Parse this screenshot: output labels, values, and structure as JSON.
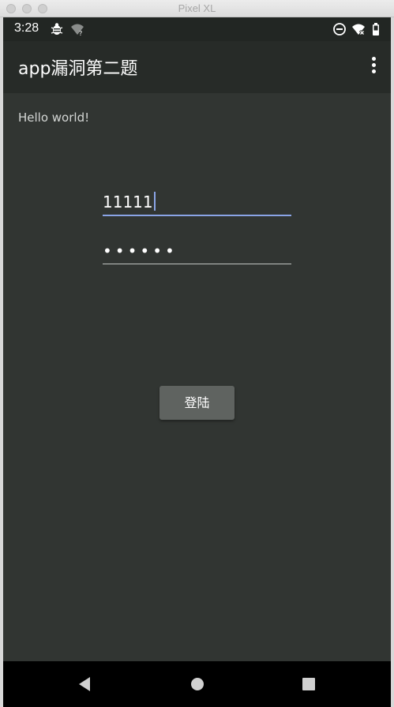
{
  "window": {
    "title": "Pixel XL"
  },
  "status_bar": {
    "time": "3:28",
    "icons": [
      "debug-bug-icon",
      "wifi-unknown-icon",
      "do-not-disturb-icon",
      "wifi-off-icon",
      "battery-icon"
    ]
  },
  "app_bar": {
    "title": "app漏洞第二题",
    "menu_icon": "overflow-menu-icon"
  },
  "main": {
    "hello_text": "Hello world!",
    "username_value": "11111",
    "password_value": "••••••",
    "login_label": "登陆"
  },
  "nav_bar": {
    "icons": [
      "back-icon",
      "home-icon",
      "recents-icon"
    ]
  },
  "colors": {
    "content_bg": "#313532",
    "app_bar_bg": "#272b28",
    "status_bar_bg": "#222623",
    "accent": "#8aa4e6",
    "button_bg": "#5f6360"
  }
}
